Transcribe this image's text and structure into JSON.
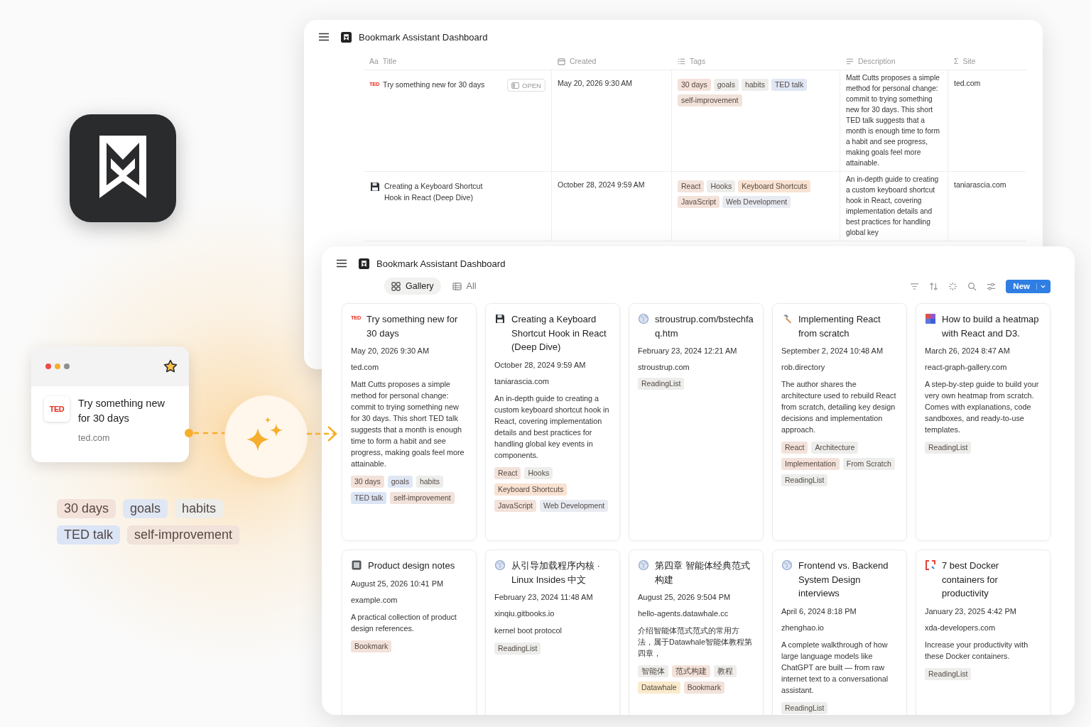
{
  "source_card": {
    "title": "Try something new for 30 days",
    "site": "ted.com",
    "logo_text": "TED"
  },
  "extracted_tags": [
    {
      "label": "30 days",
      "color": "#f3e2da"
    },
    {
      "label": "goals",
      "color": "#e0e7f4"
    },
    {
      "label": "habits",
      "color": "#ededeb"
    },
    {
      "label": "TED talk",
      "color": "#dce5f6"
    },
    {
      "label": "self-improvement",
      "color": "#f1e2da"
    }
  ],
  "table_window": {
    "title": "Bookmark Assistant Dashboard",
    "columns": [
      {
        "label": "Title",
        "glyph": "Aa"
      },
      {
        "label": "Created",
        "kind": "date"
      },
      {
        "label": "Tags",
        "kind": "multi_select"
      },
      {
        "label": "Description",
        "kind": "long_text"
      },
      {
        "label": "Site",
        "glyph": "Σ"
      }
    ],
    "rows": [
      {
        "icon": {
          "kind": "ted",
          "text": "TED"
        },
        "title": "Try something new for 30 days",
        "open_button": "OPEN",
        "created": "May 20, 2026 9:30 AM",
        "tags": [
          {
            "label": "30 days",
            "color": "#f3e2da"
          },
          {
            "label": "goals",
            "color": "#ededeb"
          },
          {
            "label": "habits",
            "color": "#ededeb"
          },
          {
            "label": "TED talk",
            "color": "#e0e7f4"
          },
          {
            "label": "self-improvement",
            "color": "#f1e2da"
          }
        ],
        "description": "Matt Cutts proposes a simple method for personal change: commit to trying something new for 30 days. This short TED talk suggests that a month is enough time to form a habit and see progress, making goals feel more attainable.",
        "site": "ted.com"
      },
      {
        "icon": {
          "kind": "floppy"
        },
        "title": "Creating a Keyboard Shortcut Hook in React (Deep Dive)",
        "created": "October 28, 2024 9:59 AM",
        "tags": [
          {
            "label": "React",
            "color": "#f3e2da"
          },
          {
            "label": "Hooks",
            "color": "#ededeb"
          },
          {
            "label": "Keyboard Shortcuts",
            "color": "#f8e2d2"
          },
          {
            "label": "JavaScript",
            "color": "#f3e2da"
          },
          {
            "label": "Web Development",
            "color": "#e8ebf1"
          }
        ],
        "description": "An in-depth guide to creating a custom keyboard shortcut hook in React, covering implementation details and best practices for handling global key",
        "site": "taniarascia.com"
      }
    ]
  },
  "gallery_window": {
    "title": "Bookmark Assistant Dashboard",
    "views": [
      {
        "label": "Gallery",
        "kind": "gallery",
        "selected": true
      },
      {
        "label": "All",
        "kind": "table",
        "selected": false
      }
    ],
    "new_button": "New",
    "cards": [
      {
        "icon": {
          "kind": "ted",
          "text": "TED"
        },
        "title": "Try something new for 30 days",
        "date": "May 20, 2026 9:30 AM",
        "site": "ted.com",
        "description": "Matt Cutts proposes a simple method for personal change: commit to trying something new for 30 days. This short TED talk suggests that a month is enough time to form a habit and see progress, making goals feel more attainable.",
        "tags": [
          {
            "label": "30 days",
            "color": "#f3e2da"
          },
          {
            "label": "goals",
            "color": "#e0e7f4"
          },
          {
            "label": "habits",
            "color": "#ededeb"
          },
          {
            "label": "TED talk",
            "color": "#dce5f6"
          },
          {
            "label": "self-improvement",
            "color": "#f1e2da"
          }
        ]
      },
      {
        "icon": {
          "kind": "floppy"
        },
        "title": "Creating a Keyboard Shortcut Hook in React (Deep Dive)",
        "date": "October 28, 2024 9:59 AM",
        "site": "taniarascia.com",
        "description": "An in-depth guide to creating a custom keyboard shortcut hook in React, covering implementation details and best practices for handling global key events in components.",
        "tags": [
          {
            "label": "React",
            "color": "#f3e2da"
          },
          {
            "label": "Hooks",
            "color": "#ededeb"
          },
          {
            "label": "Keyboard Shortcuts",
            "color": "#f8e2d2"
          },
          {
            "label": "JavaScript",
            "color": "#f3e2da"
          },
          {
            "label": "Web Development",
            "color": "#e8ebf1"
          }
        ]
      },
      {
        "icon": {
          "kind": "globe"
        },
        "title": "stroustrup.com/bstechfaq.htm",
        "date": "February 23, 2024 12:21 AM",
        "site": "stroustrup.com",
        "tags": [
          {
            "label": "ReadingList",
            "color": "#ededeb"
          }
        ]
      },
      {
        "icon": {
          "kind": "hammer"
        },
        "title": "Implementing React from scratch",
        "date": "September 2, 2024 10:48 AM",
        "site": "rob.directory",
        "description": "The author shares the architecture used to rebuild React from scratch, detailing key design decisions and implementation approach.",
        "tags": [
          {
            "label": "React",
            "color": "#f3e2da"
          },
          {
            "label": "Architecture",
            "color": "#ededeb"
          },
          {
            "label": "Implementation",
            "color": "#f3e2da"
          },
          {
            "label": "From Scratch",
            "color": "#ededeb"
          },
          {
            "label": "ReadingList",
            "color": "#ededeb"
          }
        ]
      },
      {
        "icon": {
          "kind": "heatmap"
        },
        "title": "How to build a heatmap with React and D3.",
        "date": "March 26, 2024 8:47 AM",
        "site": "react-graph-gallery.com",
        "description": "A step-by-step guide to build your very own heatmap from scratch. Comes with explanations, code sandboxes, and ready-to-use templates.",
        "tags": [
          {
            "label": "ReadingList",
            "color": "#ededeb"
          }
        ]
      },
      {
        "icon": {
          "kind": "notes"
        },
        "title": "Product design notes",
        "date": "August 25, 2026 10:41 PM",
        "site": "example.com",
        "description": "A practical collection of product design references.",
        "tags": [
          {
            "label": "Bookmark",
            "color": "#f3e2da"
          }
        ]
      },
      {
        "icon": {
          "kind": "globe"
        },
        "title": "从引导加载程序内核 · Linux Insides 中文",
        "date": "February 23, 2024 11:48 AM",
        "site": "xinqiu.gitbooks.io",
        "description": "kernel boot protocol",
        "tags": [
          {
            "label": "ReadingList",
            "color": "#ededeb"
          }
        ]
      },
      {
        "icon": {
          "kind": "globe"
        },
        "title": "第四章 智能体经典范式构建",
        "date": "August 25, 2026 9:504 PM",
        "site": "hello-agents.datawhale.cc",
        "description": "介绍智能体范式范式的常用方法，属于Datawhale智能体教程第四章，",
        "tags": [
          {
            "label": "智能体",
            "color": "#ededeb"
          },
          {
            "label": "范式构建",
            "color": "#f3e2da"
          },
          {
            "label": "教程",
            "color": "#ededeb"
          },
          {
            "label": "Datawhale",
            "color": "#f9ebcc"
          },
          {
            "label": "Bookmark",
            "color": "#f3e2da"
          }
        ]
      },
      {
        "icon": {
          "kind": "globe"
        },
        "title": "Frontend vs. Backend System Design interviews",
        "date": "April 6, 2024 8:18 PM",
        "site": "zhenghao.io",
        "description": "A complete walkthrough of how large language models like ChatGPT are built — from raw internet text to a conversational assistant.",
        "tags": [
          {
            "label": "ReadingList",
            "color": "#ededeb"
          }
        ]
      },
      {
        "icon": {
          "kind": "bracket"
        },
        "title": "7 best Docker containers for productivity",
        "date": "January 23, 2025 4:42 PM",
        "site": "xda-developers.com",
        "description": "Increase your productivity with these Docker containers.",
        "tags": [
          {
            "label": "ReadingList",
            "color": "#ededeb"
          }
        ]
      }
    ]
  }
}
